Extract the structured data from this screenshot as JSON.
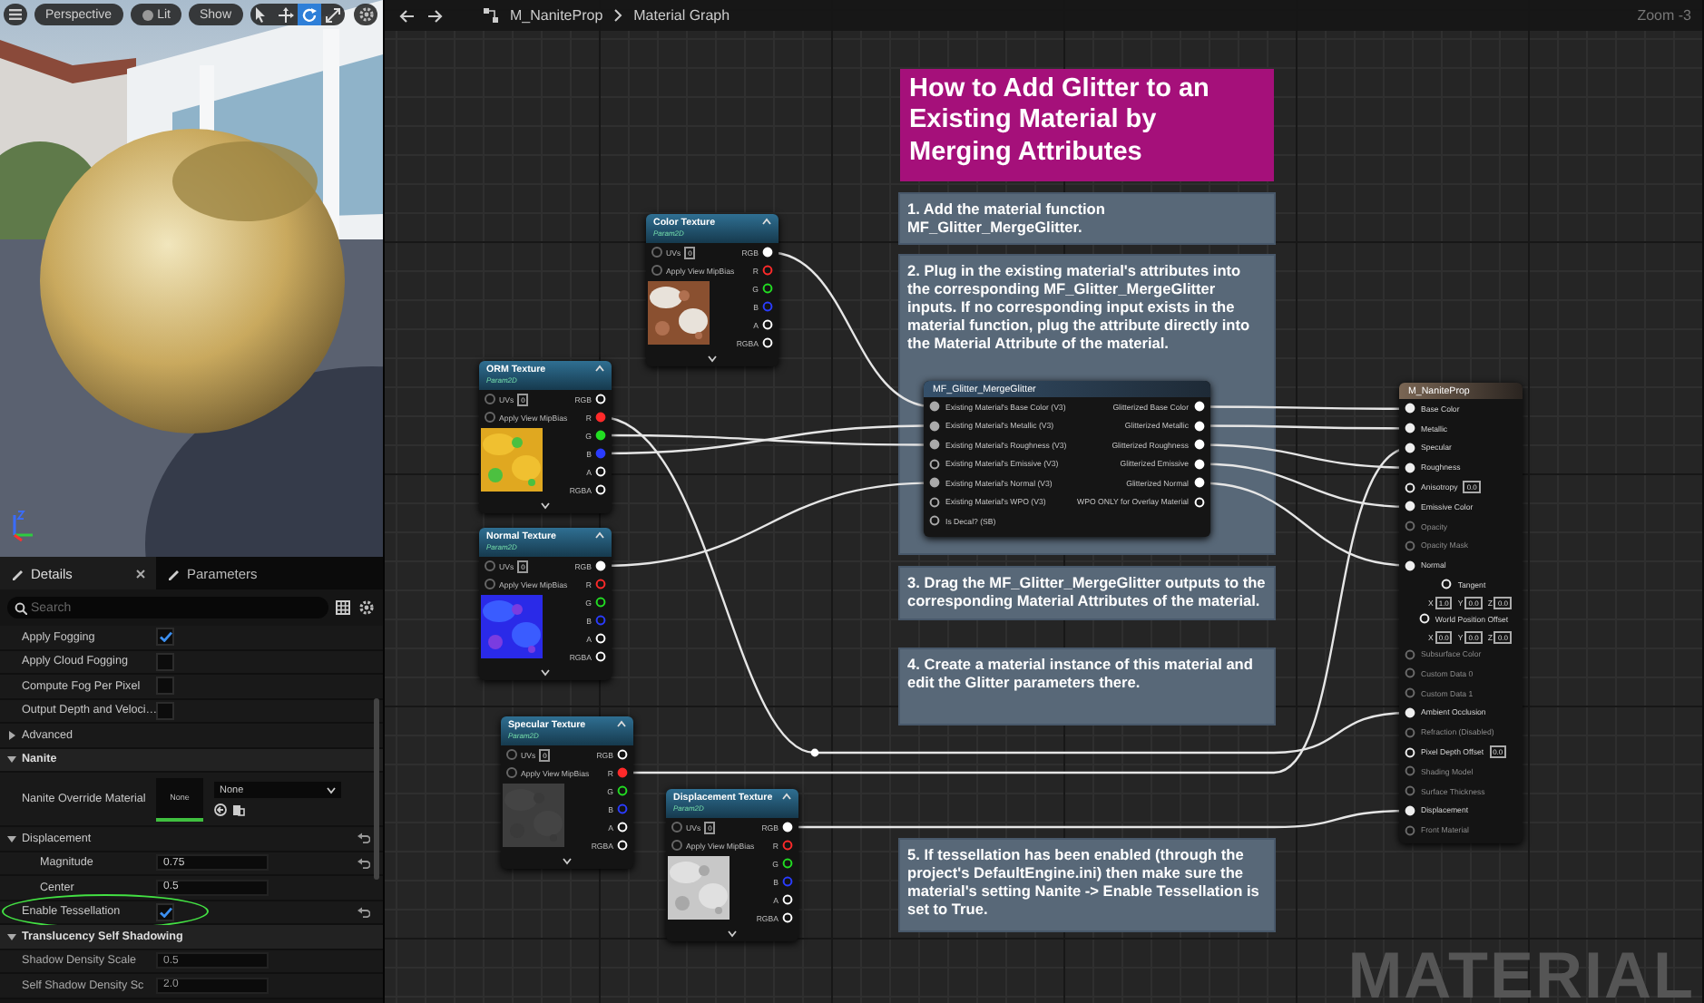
{
  "viewport": {
    "buttons": [
      {
        "kind": "menu"
      },
      {
        "kind": "text",
        "label": "Perspective"
      },
      {
        "kind": "lit",
        "label": "Lit"
      },
      {
        "kind": "text",
        "label": "Show"
      }
    ],
    "tools": [
      {
        "kind": "select",
        "selected": false
      },
      {
        "kind": "move",
        "selected": false
      },
      {
        "kind": "rotate",
        "selected": true
      },
      {
        "kind": "scale",
        "selected": false
      }
    ]
  },
  "details": {
    "tabs": [
      {
        "label": "Details",
        "selected": true,
        "closable": true
      },
      {
        "label": "Parameters",
        "selected": false,
        "closable": false
      }
    ],
    "search": {
      "placeholder": "Search"
    },
    "rows": [
      {
        "kind": "check",
        "label": "Apply Fogging",
        "checked": true
      },
      {
        "kind": "check",
        "label": "Apply Cloud Fogging",
        "checked": false
      },
      {
        "kind": "check",
        "label": "Compute Fog Per Pixel",
        "checked": false
      },
      {
        "kind": "check",
        "label": "Output Depth and Veloci…",
        "checked": false
      },
      {
        "kind": "group",
        "label": "Advanced",
        "expanded": false
      },
      {
        "kind": "section",
        "label": "Nanite",
        "expanded": true,
        "children": [
          {
            "kind": "asset",
            "label": "Nanite Override Material",
            "thumbnail": "None",
            "value": "None"
          },
          {
            "kind": "group",
            "label": "Displacement",
            "expanded": true,
            "resettable": true,
            "children": [
              {
                "kind": "number",
                "label": "Magnitude",
                "value": "0.75",
                "resettable": true,
                "disabled": false
              },
              {
                "kind": "number",
                "label": "Center",
                "value": "0.5",
                "resettable": false,
                "disabled": false
              }
            ]
          },
          {
            "kind": "check",
            "label": "Enable Tessellation",
            "checked": true,
            "resettable": true,
            "highlighted": true
          }
        ]
      },
      {
        "kind": "section",
        "label": "Translucency Self Shadowing",
        "expanded": true,
        "children": [
          {
            "kind": "number",
            "label": "Shadow Density Scale",
            "value": "0.5",
            "disabled": true
          },
          {
            "kind": "number",
            "label": "Self Shadow Density Sc",
            "value": "2.0",
            "disabled": true
          }
        ]
      }
    ]
  },
  "graph": {
    "breadcrumb": [
      "M_NaniteProp",
      "Material Graph"
    ],
    "zoom": "Zoom -3",
    "label": "MATERIAL",
    "comments": [
      {
        "kind": "title",
        "text": "How to Add Glitter to an Existing Material by Merging Attributes"
      },
      {
        "kind": "note",
        "text": "1. Add the material function MF_Glitter_MergeGlitter."
      },
      {
        "kind": "note",
        "text": "2. Plug in the existing material's attributes into the corresponding MF_Glitter_MergeGlitter inputs. If no corresponding input exists in the material function, plug the attribute directly into the Material Attribute of the material."
      },
      {
        "kind": "note",
        "text": "3. Drag the MF_Glitter_MergeGlitter outputs to the corresponding Material Attributes of the material."
      },
      {
        "kind": "note",
        "text": "4. Create a material instance of this material and edit the Glitter parameters there."
      },
      {
        "kind": "note",
        "text": "5. If tessellation has been enabled (through the project's DefaultEngine.ini) then make sure the material's setting Nanite -> Enable Tessellation is set to True."
      }
    ],
    "texture_nodes": [
      {
        "title": "Color Texture",
        "subtitle": "Param2D",
        "uvs_label": "UVs",
        "uvs": "0",
        "mip_label": "Apply View MipBias",
        "pins": [
          {
            "label": "RGB",
            "color": "#ffffff",
            "connected": true
          },
          {
            "label": "R",
            "color": "#ff2a2a",
            "connected": false
          },
          {
            "label": "G",
            "color": "#22dd22",
            "connected": false
          },
          {
            "label": "B",
            "color": "#2a3cff",
            "connected": false
          },
          {
            "label": "A",
            "color": "#ffffff",
            "connected": false
          },
          {
            "label": "RGBA",
            "color": "#ffffff",
            "connected": false
          }
        ]
      },
      {
        "title": "ORM Texture",
        "subtitle": "Param2D",
        "uvs_label": "UVs",
        "uvs": "0",
        "mip_label": "Apply View MipBias",
        "pins": [
          {
            "label": "RGB",
            "color": "#ffffff",
            "connected": false
          },
          {
            "label": "R",
            "color": "#ff2a2a",
            "connected": true
          },
          {
            "label": "G",
            "color": "#22dd22",
            "connected": true
          },
          {
            "label": "B",
            "color": "#2a3cff",
            "connected": true
          },
          {
            "label": "A",
            "color": "#ffffff",
            "connected": false
          },
          {
            "label": "RGBA",
            "color": "#ffffff",
            "connected": false
          }
        ]
      },
      {
        "title": "Normal Texture",
        "subtitle": "Param2D",
        "uvs_label": "UVs",
        "uvs": "0",
        "mip_label": "Apply View MipBias",
        "pins": [
          {
            "label": "RGB",
            "color": "#ffffff",
            "connected": true
          },
          {
            "label": "R",
            "color": "#ff2a2a",
            "connected": false
          },
          {
            "label": "G",
            "color": "#22dd22",
            "connected": false
          },
          {
            "label": "B",
            "color": "#2a3cff",
            "connected": false
          },
          {
            "label": "A",
            "color": "#ffffff",
            "connected": false
          },
          {
            "label": "RGBA",
            "color": "#ffffff",
            "connected": false
          }
        ]
      },
      {
        "title": "Specular Texture",
        "subtitle": "Param2D",
        "uvs_label": "UVs",
        "uvs": "0",
        "mip_label": "Apply View MipBias",
        "pins": [
          {
            "label": "RGB",
            "color": "#ffffff",
            "connected": false
          },
          {
            "label": "R",
            "color": "#ff2a2a",
            "connected": true
          },
          {
            "label": "G",
            "color": "#22dd22",
            "connected": false
          },
          {
            "label": "B",
            "color": "#2a3cff",
            "connected": false
          },
          {
            "label": "A",
            "color": "#ffffff",
            "connected": false
          },
          {
            "label": "RGBA",
            "color": "#ffffff",
            "connected": false
          }
        ]
      },
      {
        "title": "Displacement Texture",
        "subtitle": "Param2D",
        "uvs_label": "UVs",
        "uvs": "0",
        "mip_label": "Apply View MipBias",
        "pins": [
          {
            "label": "RGB",
            "color": "#ffffff",
            "connected": true
          },
          {
            "label": "R",
            "color": "#ff2a2a",
            "connected": false
          },
          {
            "label": "G",
            "color": "#22dd22",
            "connected": false
          },
          {
            "label": "B",
            "color": "#2a3cff",
            "connected": false
          },
          {
            "label": "A",
            "color": "#ffffff",
            "connected": false
          },
          {
            "label": "RGBA",
            "color": "#ffffff",
            "connected": false
          }
        ]
      }
    ],
    "function_node": {
      "title": "MF_Glitter_MergeGlitter",
      "inputs": [
        {
          "label": "Existing Material's Base Color (V3)",
          "connected": true
        },
        {
          "label": "Existing Material's Metallic (V3)",
          "connected": true
        },
        {
          "label": "Existing Material's Roughness (V3)",
          "connected": true
        },
        {
          "label": "Existing Material's Emissive (V3)",
          "connected": false
        },
        {
          "label": "Existing Material's Normal (V3)",
          "connected": true
        },
        {
          "label": "Existing Material's WPO (V3)",
          "connected": false
        },
        {
          "label": "Is Decal? (SB)",
          "connected": false
        }
      ],
      "outputs": [
        {
          "label": "Glitterized Base Color",
          "connected": true
        },
        {
          "label": "Glitterized Metallic",
          "connected": true
        },
        {
          "label": "Glitterized Roughness",
          "connected": true
        },
        {
          "label": "Glitterized Emissive",
          "connected": true
        },
        {
          "label": "Glitterized Normal",
          "connected": true
        },
        {
          "label": "WPO ONLY for Overlay Material",
          "connected": false
        }
      ]
    },
    "result_node": {
      "title": "M_NaniteProp",
      "pins": [
        {
          "kind": "pin",
          "label": "Base Color",
          "connected": true,
          "disabled": false
        },
        {
          "kind": "pin",
          "label": "Metallic",
          "connected": true,
          "disabled": false
        },
        {
          "kind": "pin",
          "label": "Specular",
          "connected": true,
          "disabled": false
        },
        {
          "kind": "pin",
          "label": "Roughness",
          "connected": true,
          "disabled": false
        },
        {
          "kind": "scalar",
          "label": "Anisotropy",
          "connected": false,
          "disabled": false,
          "inputs": [
            {
              "value": "0.0"
            }
          ]
        },
        {
          "kind": "pin",
          "label": "Emissive Color",
          "connected": true,
          "disabled": false
        },
        {
          "kind": "pin",
          "label": "Opacity",
          "connected": false,
          "disabled": true
        },
        {
          "kind": "pin",
          "label": "Opacity Mask",
          "connected": false,
          "disabled": true
        },
        {
          "kind": "pin",
          "label": "Normal",
          "connected": true,
          "disabled": false
        },
        {
          "kind": "vector",
          "label": "Tangent",
          "connected": false,
          "disabled": false,
          "inputs": [
            {
              "axis": "X",
              "value": "1.0"
            },
            {
              "axis": "Y",
              "value": "0.0"
            },
            {
              "axis": "Z",
              "value": "0.0"
            }
          ]
        },
        {
          "kind": "vector",
          "label": "World Position Offset",
          "connected": false,
          "disabled": false,
          "inputs": [
            {
              "axis": "X",
              "value": "0.0"
            },
            {
              "axis": "Y",
              "value": "0.0"
            },
            {
              "axis": "Z",
              "value": "0.0"
            }
          ]
        },
        {
          "kind": "pin",
          "label": "Subsurface Color",
          "connected": false,
          "disabled": true
        },
        {
          "kind": "pin",
          "label": "Custom Data 0",
          "connected": false,
          "disabled": true
        },
        {
          "kind": "pin",
          "label": "Custom Data 1",
          "connected": false,
          "disabled": true
        },
        {
          "kind": "pin",
          "label": "Ambient Occlusion",
          "connected": true,
          "disabled": false
        },
        {
          "kind": "pin",
          "label": "Refraction (Disabled)",
          "connected": false,
          "disabled": true
        },
        {
          "kind": "scalar",
          "label": "Pixel Depth Offset",
          "connected": false,
          "disabled": false,
          "inputs": [
            {
              "value": "0.0"
            }
          ]
        },
        {
          "kind": "pin",
          "label": "Shading Model",
          "connected": false,
          "disabled": true
        },
        {
          "kind": "pin",
          "label": "Surface Thickness",
          "connected": false,
          "disabled": true
        },
        {
          "kind": "pin",
          "label": "Displacement",
          "connected": true,
          "disabled": false
        },
        {
          "kind": "pin",
          "label": "Front Material",
          "connected": false,
          "disabled": true
        }
      ]
    }
  }
}
